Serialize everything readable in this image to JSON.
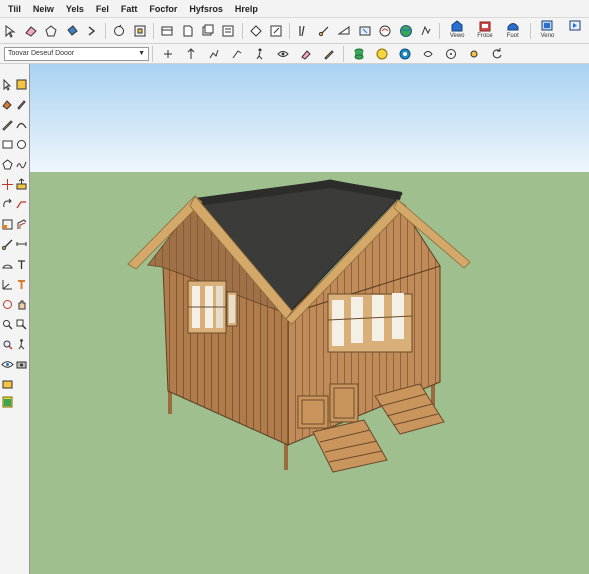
{
  "menu": {
    "items": [
      "Tiil",
      "Neiw",
      "Yels",
      "Fel",
      "Fatt",
      "Focfor",
      "Hyfsros",
      "Hrelp"
    ]
  },
  "toolbar": {
    "style_dropdown": "Toovar Deseuf Dooor",
    "view_buttons": [
      "Vewo",
      "Froce",
      "Fuot"
    ],
    "end_button": "Veno"
  },
  "colors": {
    "sky_top": "#a9d2f2",
    "sky_bottom": "#eef6fc",
    "ground": "#9fbf8f",
    "wall": "#b98554",
    "roof": "#3b3b39",
    "trim": "#d4a869"
  }
}
